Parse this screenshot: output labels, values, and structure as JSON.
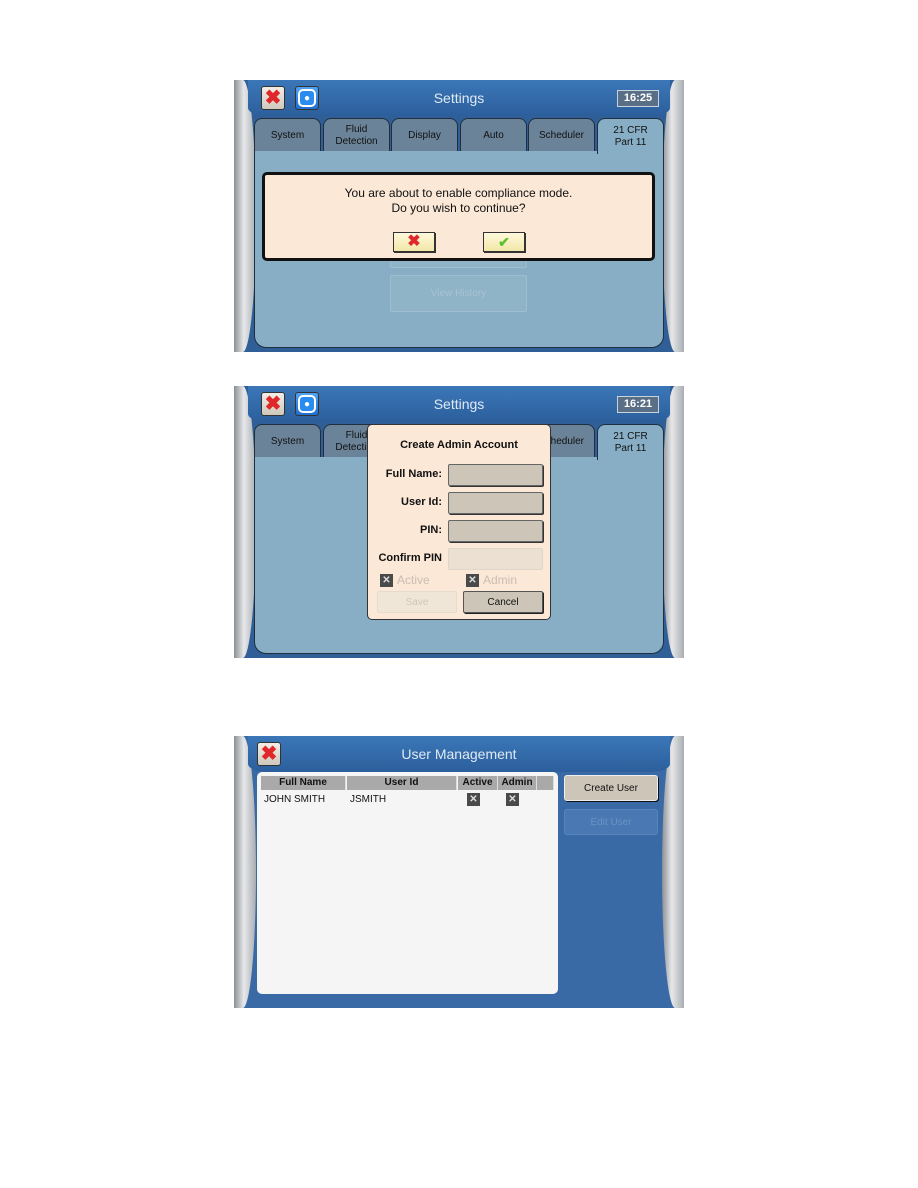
{
  "screen1": {
    "title": "Settings",
    "clock": "16:25",
    "tabs": [
      {
        "label": "System"
      },
      {
        "label": "Fluid Detection"
      },
      {
        "label": "Display"
      },
      {
        "label": "Auto"
      },
      {
        "label": "Scheduler"
      },
      {
        "label": "21 CFR Part 11"
      }
    ],
    "active_tab": "21 CFR Part 11",
    "dialog": {
      "line1": "You are about to enable compliance mode.",
      "line2": "Do you wish to continue?",
      "cancel_icon": "x-icon",
      "confirm_icon": "check-icon"
    },
    "background_buttons": [
      {
        "label": ""
      },
      {
        "label": "View History"
      }
    ]
  },
  "screen2": {
    "title": "Settings",
    "clock": "16:21",
    "tabs": [
      {
        "label": "System"
      },
      {
        "label": "Fluid Detection"
      },
      {
        "label": "Scheduler"
      },
      {
        "label": "21 CFR Part 11"
      }
    ],
    "dialog": {
      "title": "Create Admin Account",
      "fields": [
        {
          "label": "Full Name:",
          "value": ""
        },
        {
          "label": "User Id:",
          "value": ""
        },
        {
          "label": "PIN:",
          "value": ""
        },
        {
          "label": "Confirm PIN",
          "value": ""
        }
      ],
      "checkboxes": [
        {
          "label": "Active",
          "checked": true
        },
        {
          "label": "Admin",
          "checked": true
        }
      ],
      "save_label": "Save",
      "cancel_label": "Cancel"
    }
  },
  "screen3": {
    "title": "User Management",
    "columns": [
      "Full Name",
      "User Id",
      "Active",
      "Admin"
    ],
    "rows": [
      {
        "full_name": "JOHN SMITH",
        "user_id": "JSMITH",
        "active": true,
        "admin": true
      }
    ],
    "create_user_label": "Create User",
    "edit_user_label": "Edit User"
  },
  "colors": {
    "header_blue": "#2f5f96",
    "panel": "#87aec5",
    "dialog_bg": "#fbe8d7",
    "close_red": "#e0282b",
    "check_green": "#5cc22d"
  }
}
